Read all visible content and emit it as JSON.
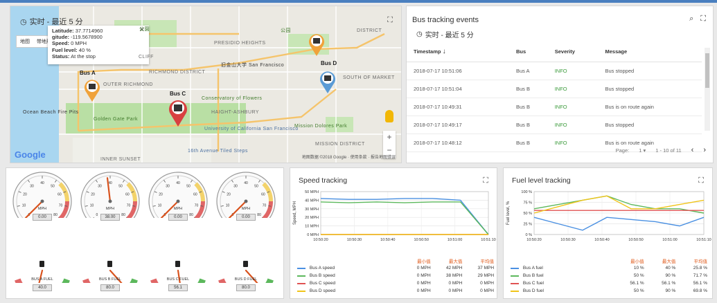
{
  "map": {
    "time_label": "实时 - 最近 5 分",
    "tabs": [
      "地图",
      "带地形"
    ],
    "popup": {
      "lines": [
        {
          "key": "Latitude:",
          "val": "37.7714960"
        },
        {
          "key": "gitude:",
          "val": "-119.5678900"
        },
        {
          "key": "Speed:",
          "val": "0 MPH"
        },
        {
          "key": "Fuel level:",
          "val": "40 %"
        },
        {
          "key": "Status:",
          "val": "At the stop"
        }
      ]
    },
    "labels": [
      "PRESIDIO HEIGHTS",
      "RICHMOND DISTRICT",
      "OUTER RICHMOND",
      "INNER SUNSET",
      "SOUTH OF MARKET",
      "MISSION DISTRICT",
      "DISTRICT",
      "CLIFF",
      "Ocean Beach Fire Pits",
      "Golden Gate Park",
      "Conservatory of Flowers",
      "University of California San Francisco",
      "16th Avenue Tiled Steps",
      "Mission Dolores Park",
      "HAIGHT-ASHBURY",
      "旧金山大学 San Francisco",
      "公園",
      "公园"
    ],
    "bus_labels": [
      "Bus A",
      "Bus C",
      "Bus D"
    ],
    "google": "Google",
    "attribution": "地图数据 ©2018 Google · 使用条款 · 报告地图错误"
  },
  "events": {
    "title": "Bus tracking events",
    "time_label": "实时 - 最近 5 分",
    "columns": [
      "Timestamp",
      "Bus",
      "Severity",
      "Message"
    ],
    "rows": [
      [
        "2018-07-17 10:51:06",
        "Bus A",
        "INFO",
        "Bus stopped"
      ],
      [
        "2018-07-17 10:51:04",
        "Bus B",
        "INFO",
        "Bus stopped"
      ],
      [
        "2018-07-17 10:49:31",
        "Bus B",
        "INFO",
        "Bus is on route again"
      ],
      [
        "2018-07-17 10:49:17",
        "Bus B",
        "INFO",
        "Bus stopped"
      ],
      [
        "2018-07-17 10:48:12",
        "Bus B",
        "INFO",
        "Bus is on route again"
      ]
    ],
    "pager": {
      "page_label": "Page:",
      "page": "1",
      "range": "1 - 10 of 11"
    }
  },
  "gauges": {
    "speed": [
      {
        "label": "MPH",
        "readout": "0.00",
        "value": 0
      },
      {
        "label": "MPH",
        "readout": "38.00",
        "value": 38
      },
      {
        "label": "MPH",
        "readout": "0.00",
        "value": 0
      },
      {
        "label": "MPH",
        "readout": "0.00",
        "value": 0
      }
    ],
    "fuel": [
      {
        "label": "BUS A FUEL",
        "readout": "40.0",
        "value": 40
      },
      {
        "label": "BUS B FUEL",
        "readout": "80.0",
        "value": 80
      },
      {
        "label": "BUS C FUEL",
        "readout": "56.1",
        "value": 56.1
      },
      {
        "label": "BUS D FUEL",
        "readout": "80.0",
        "value": 80
      }
    ],
    "speed_ticks": [
      "0",
      "10",
      "20",
      "30",
      "40",
      "50",
      "60",
      "70",
      "80"
    ]
  },
  "speed_chart": {
    "title": "Speed tracking",
    "legend_headers": [
      "最小值",
      "最大值",
      "平均值"
    ],
    "legend": [
      {
        "name": "Bus A speed",
        "min": "0 MPH",
        "max": "42 MPH",
        "avg": "37 MPH",
        "color": "#4a90e2"
      },
      {
        "name": "Bus B speed",
        "min": "0 MPH",
        "max": "38 MPH",
        "avg": "29 MPH",
        "color": "#5cb85c"
      },
      {
        "name": "Bus C speed",
        "min": "0 MPH",
        "max": "0 MPH",
        "avg": "0 MPH",
        "color": "#e05252"
      },
      {
        "name": "Bus D speed",
        "min": "0 MPH",
        "max": "0 MPH",
        "avg": "0 MPH",
        "color": "#f0c419"
      }
    ]
  },
  "fuel_chart": {
    "title": "Fuel level tracking",
    "legend_headers": [
      "最小值",
      "最大值",
      "平均值"
    ],
    "legend": [
      {
        "name": "Bus A fuel",
        "min": "10 %",
        "max": "40 %",
        "avg": "25.8 %",
        "color": "#4a90e2"
      },
      {
        "name": "Bus B fuel",
        "min": "50 %",
        "max": "90 %",
        "avg": "71.7 %",
        "color": "#5cb85c"
      },
      {
        "name": "Bus C fuel",
        "min": "56.1 %",
        "max": "56.1 %",
        "avg": "56.1 %",
        "color": "#e05252"
      },
      {
        "name": "Bus D fuel",
        "min": "50 %",
        "max": "90 %",
        "avg": "69.8 %",
        "color": "#f0c419"
      }
    ]
  },
  "chart_data": [
    {
      "type": "line",
      "title": "Speed tracking",
      "ylabel": "Speed, MPH",
      "x": [
        "10:50:20",
        "10:50:30",
        "10:50:40",
        "10:50:50",
        "10:51:00",
        "10:51:10"
      ],
      "yticks": [
        "0 MPH",
        "10 MPH",
        "20 MPH",
        "30 MPH",
        "40 MPH",
        "50 MPH"
      ],
      "ylim": [
        0,
        50
      ],
      "series": [
        {
          "name": "Bus A speed",
          "values": [
            42,
            41,
            41,
            42,
            42,
            40,
            0
          ]
        },
        {
          "name": "Bus B speed",
          "values": [
            38,
            37,
            38,
            37,
            38,
            38,
            0
          ]
        },
        {
          "name": "Bus C speed",
          "values": [
            0,
            0,
            0,
            0,
            0,
            0,
            0
          ]
        },
        {
          "name": "Bus D speed",
          "values": [
            0,
            0,
            0,
            0,
            0,
            0,
            0
          ]
        }
      ]
    },
    {
      "type": "line",
      "title": "Fuel level tracking",
      "ylabel": "Fuel level, %",
      "x": [
        "10:50:20",
        "10:50:30",
        "10:50:40",
        "10:50:50",
        "10:51:00",
        "10:51:10"
      ],
      "yticks": [
        "0 %",
        "25 %",
        "50 %",
        "75 %",
        "100 %"
      ],
      "ylim": [
        0,
        100
      ],
      "series": [
        {
          "name": "Bus A fuel",
          "values": [
            40,
            25,
            10,
            40,
            35,
            30,
            20,
            40
          ]
        },
        {
          "name": "Bus B fuel",
          "values": [
            60,
            70,
            80,
            90,
            70,
            60,
            60,
            50
          ]
        },
        {
          "name": "Bus C fuel",
          "values": [
            56.1,
            56.1,
            56.1,
            56.1,
            56.1,
            56.1,
            56.1,
            56.1
          ]
        },
        {
          "name": "Bus D fuel",
          "values": [
            50,
            65,
            80,
            90,
            60,
            60,
            70,
            80
          ]
        }
      ]
    }
  ]
}
